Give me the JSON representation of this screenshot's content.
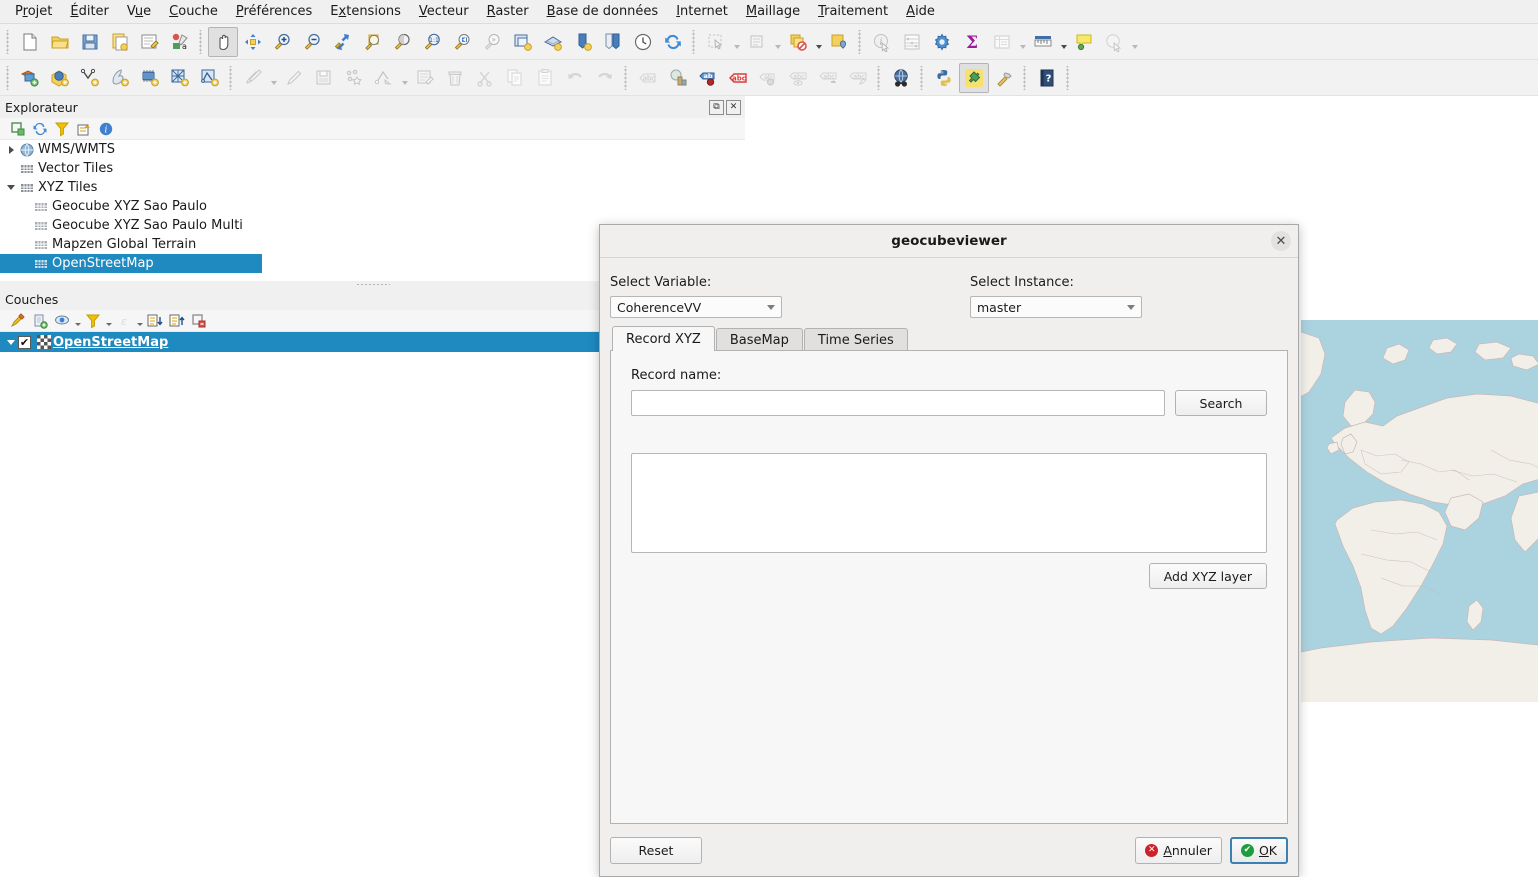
{
  "menubar": {
    "items": [
      {
        "pre": "P",
        "accel": "r",
        "post": "ojet"
      },
      {
        "pre": "",
        "accel": "É",
        "post": "diter"
      },
      {
        "pre": "V",
        "accel": "u",
        "post": "e"
      },
      {
        "pre": "",
        "accel": "C",
        "post": "ouche"
      },
      {
        "pre": "",
        "accel": "P",
        "post": "références"
      },
      {
        "pre": "E",
        "accel": "x",
        "post": "tensions"
      },
      {
        "pre": "",
        "accel": "V",
        "post": "ecteur"
      },
      {
        "pre": "",
        "accel": "R",
        "post": "aster"
      },
      {
        "pre": "",
        "accel": "B",
        "post": "ase de données"
      },
      {
        "pre": "",
        "accel": "I",
        "post": "nternet"
      },
      {
        "pre": "",
        "accel": "M",
        "post": "aillage"
      },
      {
        "pre": "",
        "accel": "T",
        "post": "raitement"
      },
      {
        "pre": "",
        "accel": "A",
        "post": "ide"
      }
    ]
  },
  "toolbar_row1": {
    "icons": [
      "new-project-icon",
      "open-project-icon",
      "save-project-icon",
      "save-project-as-icon",
      "project-properties-icon",
      "style-manager-icon",
      "pan-map-icon",
      "pan-to-selection-icon",
      "zoom-in-icon",
      "zoom-out-icon",
      "zoom-full-icon",
      "zoom-to-selection-icon",
      "zoom-to-layer-icon",
      "zoom-native-icon",
      "zoom-last-icon",
      "zoom-next-icon",
      "new-map-view-icon",
      "new-3d-map-view-icon",
      "new-print-layout-icon",
      "layout-manager-icon",
      "temporal-controller-icon",
      "refresh-icon",
      "select-features-icon",
      "deselect-icon",
      "select-by-expression-icon",
      "select-location-icon",
      "identify-features-icon",
      "open-field-calculator-icon",
      "options-icon",
      "statistical-summary-icon",
      "open-attribute-table-icon",
      "measure-line-icon",
      "map-tips-icon",
      "show-overview-icon"
    ]
  },
  "toolbar_row2": {
    "icons": [
      "add-vector-layer-icon",
      "add-raster-layer-icon",
      "add-delimited-text-layer-icon",
      "add-postgis-layer-icon",
      "add-spatialite-layer-icon",
      "add-wms-layer-icon",
      "add-wcs-layer-icon",
      "toggle-editing-icon",
      "edit-pencil-icon",
      "save-layer-edits-icon",
      "add-feature-icon",
      "vertex-tool-icon",
      "modify-attributes-icon",
      "delete-selected-icon",
      "cut-features-icon",
      "copy-features-icon",
      "paste-features-icon",
      "undo-icon",
      "redo-icon",
      "label-icon",
      "layer-diagram-icon",
      "pin-labels-icon",
      "highlight-labels-icon",
      "move-label-icon",
      "show-hide-labels-icon",
      "rotate-label-icon",
      "change-label-icon",
      "metasearch-icon",
      "python-console-icon",
      "plugin-manager-icon",
      "plugin-builder-icon",
      "help-icon"
    ]
  },
  "explorer_panel": {
    "title": "Explorateur",
    "float_button": "⧉",
    "close_button": "✕",
    "tools": [
      "add-layer-icon",
      "refresh-icon",
      "filter-icon",
      "collapse-all-icon",
      "properties-icon"
    ],
    "tree": [
      {
        "label": "WMS/WMTS",
        "indent": 0,
        "twisty": "right",
        "icon": "globe-icon",
        "selected": false
      },
      {
        "label": "Vector Tiles",
        "indent": 0,
        "twisty": "none",
        "icon": "tiles-icon",
        "selected": false
      },
      {
        "label": "XYZ Tiles",
        "indent": 0,
        "twisty": "down",
        "icon": "tiles-icon",
        "selected": false
      },
      {
        "label": "Geocube XYZ Sao Paulo",
        "indent": 1,
        "twisty": "none",
        "icon": "tiles-icon",
        "selected": false
      },
      {
        "label": "Geocube XYZ Sao Paulo Multi",
        "indent": 1,
        "twisty": "none",
        "icon": "tiles-icon",
        "selected": false
      },
      {
        "label": "Mapzen Global Terrain",
        "indent": 1,
        "twisty": "none",
        "icon": "tiles-icon",
        "selected": false
      },
      {
        "label": "OpenStreetMap",
        "indent": 1,
        "twisty": "none",
        "icon": "tiles-icon",
        "selected": true
      }
    ]
  },
  "layers_panel": {
    "title": "Couches",
    "tools": [
      "open-layer-styling-icon",
      "add-group-icon",
      "manage-map-themes-icon",
      "filter-legend-icon",
      "filter-legend-expression-icon",
      "expand-all-icon",
      "collapse-all-icon",
      "remove-layer-icon"
    ],
    "layers": [
      {
        "label": "OpenStreetMap",
        "checked": true,
        "check_glyph": "✔"
      }
    ]
  },
  "dialog": {
    "title": "geocubeviewer",
    "close_glyph": "✕",
    "variable": {
      "label": "Select Variable:",
      "value": "CoherenceVV"
    },
    "instance": {
      "label": "Select Instance:",
      "value": "master"
    },
    "tabs": [
      {
        "label": "Record XYZ",
        "active": true
      },
      {
        "label": "BaseMap",
        "active": false
      },
      {
        "label": "Time Series",
        "active": false
      }
    ],
    "record_name_label": "Record name:",
    "record_name_value": "",
    "search_button": "Search",
    "results_value": "",
    "add_layer_button": "Add XYZ layer",
    "reset_button": "Reset",
    "cancel": {
      "pre": "",
      "accel": "A",
      "post": "nnuler",
      "icon_glyph": "✕"
    },
    "ok": {
      "pre": "",
      "accel": "O",
      "post": "K",
      "icon_glyph": "✔"
    }
  },
  "map": {
    "layer_name": "OpenStreetMap",
    "colors": {
      "ocean": "#aad3df",
      "land": "#f2efe9",
      "border": "#cbb7b7"
    }
  },
  "colors": {
    "selection_blue": "#1f8ac0",
    "chrome": "#f0f0f0",
    "dialog_bg": "#f0efee"
  }
}
